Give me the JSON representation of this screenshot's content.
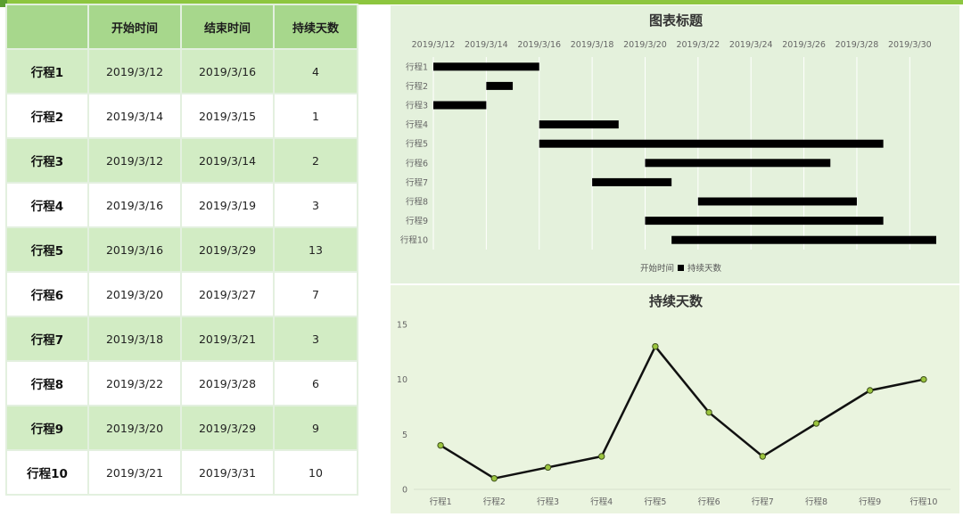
{
  "table": {
    "headers": [
      "",
      "开始时间",
      "结束时间",
      "持续天数"
    ],
    "rows": [
      [
        "行程1",
        "2019/3/12",
        "2019/3/16",
        "4"
      ],
      [
        "行程2",
        "2019/3/14",
        "2019/3/15",
        "1"
      ],
      [
        "行程3",
        "2019/3/12",
        "2019/3/14",
        "2"
      ],
      [
        "行程4",
        "2019/3/16",
        "2019/3/19",
        "3"
      ],
      [
        "行程5",
        "2019/3/16",
        "2019/3/29",
        "13"
      ],
      [
        "行程6",
        "2019/3/20",
        "2019/3/27",
        "7"
      ],
      [
        "行程7",
        "2019/3/18",
        "2019/3/21",
        "3"
      ],
      [
        "行程8",
        "2019/3/22",
        "2019/3/28",
        "6"
      ],
      [
        "行程9",
        "2019/3/20",
        "2019/3/29",
        "9"
      ],
      [
        "行程10",
        "2019/3/21",
        "2019/3/31",
        "10"
      ]
    ]
  },
  "colors": {
    "header_bg": "#a7d78c",
    "row_band": "#d2ecc4",
    "accent": "#8dc63f",
    "bar": "#000000",
    "marker": "#9bc53d"
  },
  "chart_data": [
    {
      "type": "bar",
      "orientation": "horizontal",
      "stacked": true,
      "title": "图表标题",
      "categories": [
        "行程1",
        "行程2",
        "行程3",
        "行程4",
        "行程5",
        "行程6",
        "行程7",
        "行程8",
        "行程9",
        "行程10"
      ],
      "series": [
        {
          "name": "开始时间",
          "values": [
            "2019/3/12",
            "2019/3/14",
            "2019/3/12",
            "2019/3/16",
            "2019/3/16",
            "2019/3/20",
            "2019/3/18",
            "2019/3/22",
            "2019/3/20",
            "2019/3/21"
          ],
          "visible": false
        },
        {
          "name": "持续天数",
          "values": [
            4,
            1,
            2,
            3,
            13,
            7,
            3,
            6,
            9,
            10
          ],
          "color": "#000000"
        }
      ],
      "x_tick_labels": [
        "2019/3/12",
        "2019/3/14",
        "2019/3/16",
        "2019/3/18",
        "2019/3/20",
        "2019/3/22",
        "2019/3/24",
        "2019/3/26",
        "2019/3/28",
        "2019/3/30"
      ],
      "xlim": [
        "2019/3/12",
        "2019/3/31"
      ],
      "x_axis_position": "top",
      "grid": true,
      "legend": "bottom",
      "legend_entries": [
        "开始时间",
        "持续天数"
      ]
    },
    {
      "type": "line",
      "title": "持续天数",
      "categories": [
        "行程1",
        "行程2",
        "行程3",
        "行程4",
        "行程5",
        "行程6",
        "行程7",
        "行程8",
        "行程9",
        "行程10"
      ],
      "series": [
        {
          "name": "持续天数",
          "values": [
            4,
            1,
            2,
            3,
            13,
            7,
            3,
            6,
            9,
            10
          ]
        }
      ],
      "y_tick_labels": [
        "0",
        "5",
        "10",
        "15"
      ],
      "ylim": [
        0,
        15
      ],
      "grid": false,
      "legend": "none"
    }
  ]
}
